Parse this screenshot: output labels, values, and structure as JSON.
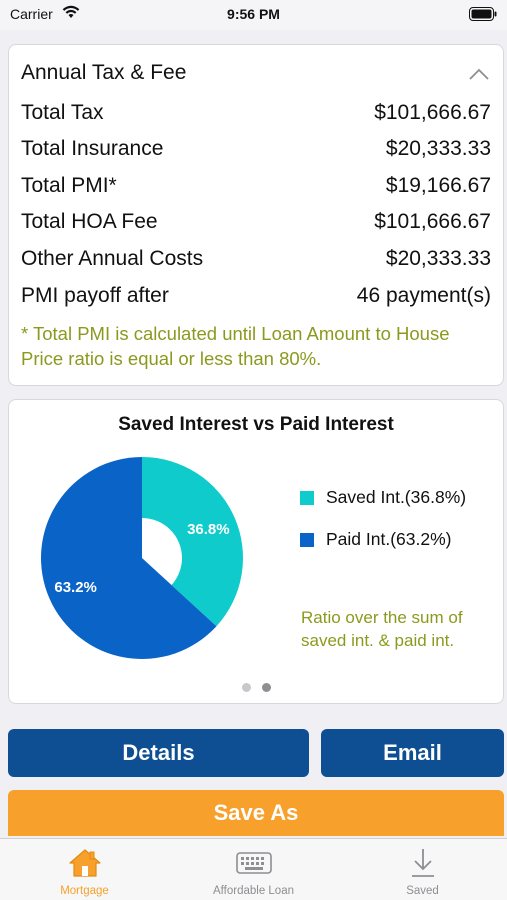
{
  "status_bar": {
    "carrier": "Carrier",
    "time": "9:56 PM"
  },
  "tax_card": {
    "title": "Annual Tax & Fee",
    "rows": [
      {
        "label": "Total Tax",
        "value": "$101,666.67"
      },
      {
        "label": "Total Insurance",
        "value": "$20,333.33"
      },
      {
        "label": "Total PMI*",
        "value": "$19,166.67"
      },
      {
        "label": "Total HOA Fee",
        "value": "$101,666.67"
      },
      {
        "label": "Other Annual Costs",
        "value": "$20,333.33"
      },
      {
        "label": "PMI payoff after",
        "value": "46 payment(s)"
      }
    ],
    "note": "* Total PMI is calculated until Loan Amount to House Price ratio is equal or less than 80%."
  },
  "chart_card": {
    "ratio_note": "Ratio over the sum of saved int. & paid int.",
    "page_count": 2,
    "active_page": 2
  },
  "chart_data": {
    "type": "pie",
    "title": "Saved Interest vs Paid Interest",
    "donut": true,
    "legend_position": "right",
    "slices": [
      {
        "name": "Saved Int.",
        "legend": "Saved Int.(36.8%)",
        "value": 36.8,
        "label": "36.8%",
        "color": "#10cbcb"
      },
      {
        "name": "Paid Int.",
        "legend": "Paid Int.(63.2%)",
        "value": 63.2,
        "label": "63.2%",
        "color": "#0a64c8"
      }
    ]
  },
  "buttons": {
    "details": "Details",
    "email": "Email",
    "save_as": "Save As"
  },
  "tab_bar": {
    "items": [
      {
        "label": "Mortgage",
        "icon": "house-icon",
        "active": true
      },
      {
        "label": "Affordable Loan",
        "icon": "keyboard-icon",
        "active": false
      },
      {
        "label": "Saved",
        "icon": "download-icon",
        "active": false
      }
    ]
  },
  "colors": {
    "accent_orange": "#f7a12c",
    "button_blue": "#0e4f93",
    "note_olive": "#8b9a1e"
  }
}
